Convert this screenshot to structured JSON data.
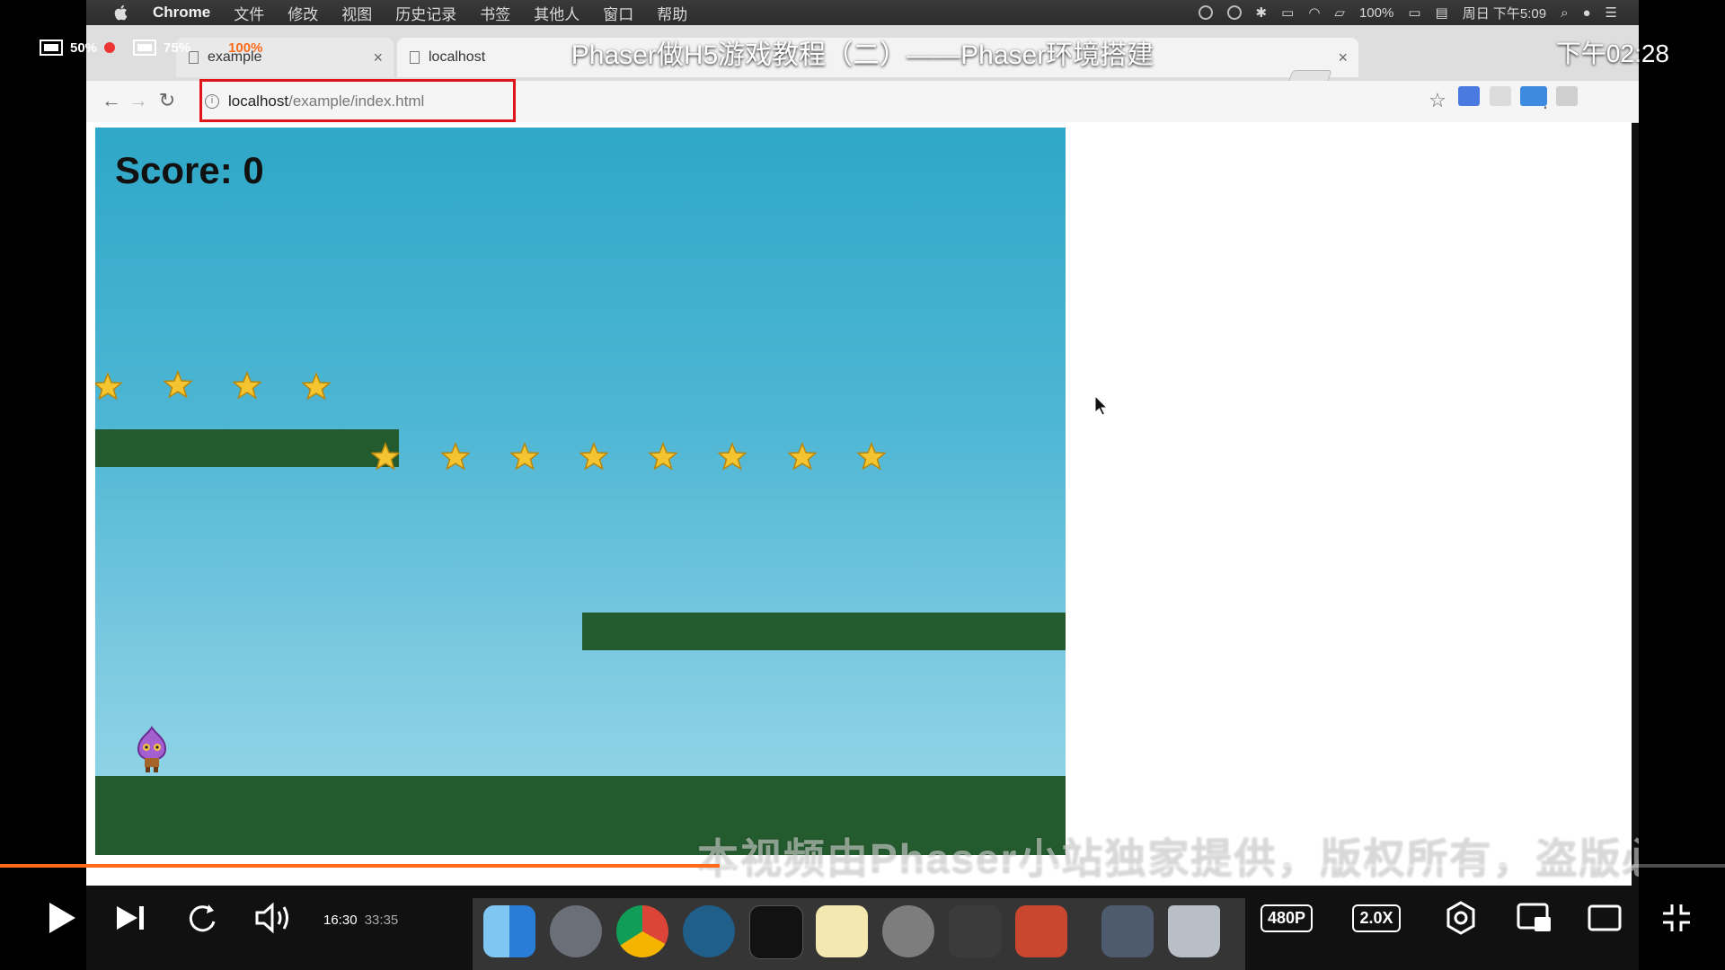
{
  "video": {
    "title": "Phaser做H5游戏教程（二）——Phaser环境搭建",
    "clock": "下午02:28",
    "hud": {
      "screen_pct": "50%",
      "battery_pct": "75%",
      "other_pct": "100%"
    },
    "current_time": "16:30",
    "total_time": "33:35",
    "progress": 0.417,
    "quality": "480P",
    "speed": "2.0X",
    "accent": "#ff6a1a"
  },
  "mac": {
    "app_name": "Chrome",
    "menus": [
      "文件",
      "修改",
      "视图",
      "历史记录",
      "书签",
      "其他人",
      "窗口",
      "帮助"
    ],
    "battery": "100%",
    "datetime": "周日 下午5:09"
  },
  "browser": {
    "tabs": [
      {
        "label": "example"
      },
      {
        "label": "localhost"
      }
    ],
    "url_host": "localhost",
    "url_path": "/example/index.html",
    "highlight_color": "#e0151b"
  },
  "game": {
    "score_text": "Score: 0",
    "star_count": 12,
    "platform_color": "#245b2e"
  },
  "watermark": "本视频由Phaser小站独家提供，版权所有，盗版必究",
  "icons": {
    "dock": [
      "finder-icon",
      "launchpad-icon",
      "chrome-icon",
      "quicktime-icon",
      "terminal-icon",
      "notes-icon",
      "system-preferences-icon",
      "sublime-text-icon",
      "powerpoint-icon",
      "files-icon",
      "trash-icon"
    ]
  }
}
